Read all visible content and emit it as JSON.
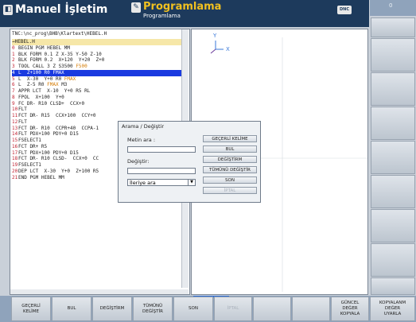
{
  "header": {
    "mode_machine": "Manuel İşletim",
    "mode_program_title": "Programlama",
    "mode_program_sub": "Programlama",
    "dnc_label": "DNC",
    "clock": "0"
  },
  "program": {
    "path": "TNC:\\nc_prog\\BHB\\Klartext\\HEBEL.H",
    "file_tab": "→HEBEL.H",
    "lines": [
      {
        "n": "0",
        "t": "BEGIN PGM HEBEL MM"
      },
      {
        "n": "1",
        "t": "BLK FORM 0.1 Z X-35 Y-50 Z-10"
      },
      {
        "n": "2",
        "t": "BLK FORM 0.2  X+120  Y+20  Z+0"
      },
      {
        "n": "3",
        "t": "TOOL CALL 3 Z S3500 ",
        "f": "F500"
      },
      {
        "n": "4",
        "t": "L  Z+100 R0 FMAX"
      },
      {
        "n": "5",
        "t": "L  X-30  Y+0 R0 ",
        "f": "FMAX"
      },
      {
        "n": "6",
        "t": "L  Z-5 R0 ",
        "f": "FMAX",
        "t2": " M3"
      },
      {
        "n": "7",
        "t": "APPR LCT  X-10  Y+0 R5 RL"
      },
      {
        "n": "8",
        "t": "FPOL  X+100  Y+0"
      },
      {
        "n": "9",
        "t": "FC DR- R10 CLSD+  CCX+0"
      },
      {
        "n": "10",
        "t": "FLT"
      },
      {
        "n": "11",
        "t": "FCT DR- R15  CCX+100  CCY+0"
      },
      {
        "n": "12",
        "t": "FLT"
      },
      {
        "n": "13",
        "t": "FCT DR- R10  CCPR+40  CCPA-1"
      },
      {
        "n": "14",
        "t": "FLT PDX+100 PDY+0 D15"
      },
      {
        "n": "15",
        "t": "FSELECT1"
      },
      {
        "n": "16",
        "t": "FCT DR+ R5"
      },
      {
        "n": "17",
        "t": "FLT PDX+100 PDY+0 D15"
      },
      {
        "n": "18",
        "t": "FCT DR- R10 CLSD-  CCX+0  CC"
      },
      {
        "n": "19",
        "t": "FSELECT1"
      },
      {
        "n": "20",
        "t": "DEP LCT  X-30  Y+0  Z+100 R5"
      },
      {
        "n": "21",
        "t": "END PGM HEBEL MM"
      }
    ]
  },
  "dialog": {
    "title": "Arama / Değiştir",
    "search_label": "Metin ara :",
    "search_value": "",
    "replace_label": "Değiştir:",
    "replace_value": "",
    "direction": "İleriye ara",
    "btn_current_word": "GEÇERLİ KELİME",
    "btn_find": "BUL",
    "btn_replace": "DEĞİŞTİRM",
    "btn_replace_all": "TÜMÜNÜ DEĞİŞTİR",
    "btn_end": "SON",
    "btn_cancel": "İPTAL"
  },
  "softkeys": [
    "GEÇERLİ\nKELİME",
    "BUL",
    "DEĞİŞTİRM",
    "TÜMÜNÜ\nDEĞİŞTİR",
    "SON",
    "İPTAL",
    "",
    "",
    "GÜNCEL\nDEĞER\nKOPYALA",
    "KOPYALANM\nDEĞER\nUYARLA"
  ],
  "graphic": {
    "axis_y": "Y",
    "axis_x": "X"
  },
  "colors": {
    "header_bg": "#1d3a5c",
    "accent": "#f0c020",
    "selection": "#1a3ae0",
    "line_number": "#c12030",
    "feed": "#d47a00"
  }
}
